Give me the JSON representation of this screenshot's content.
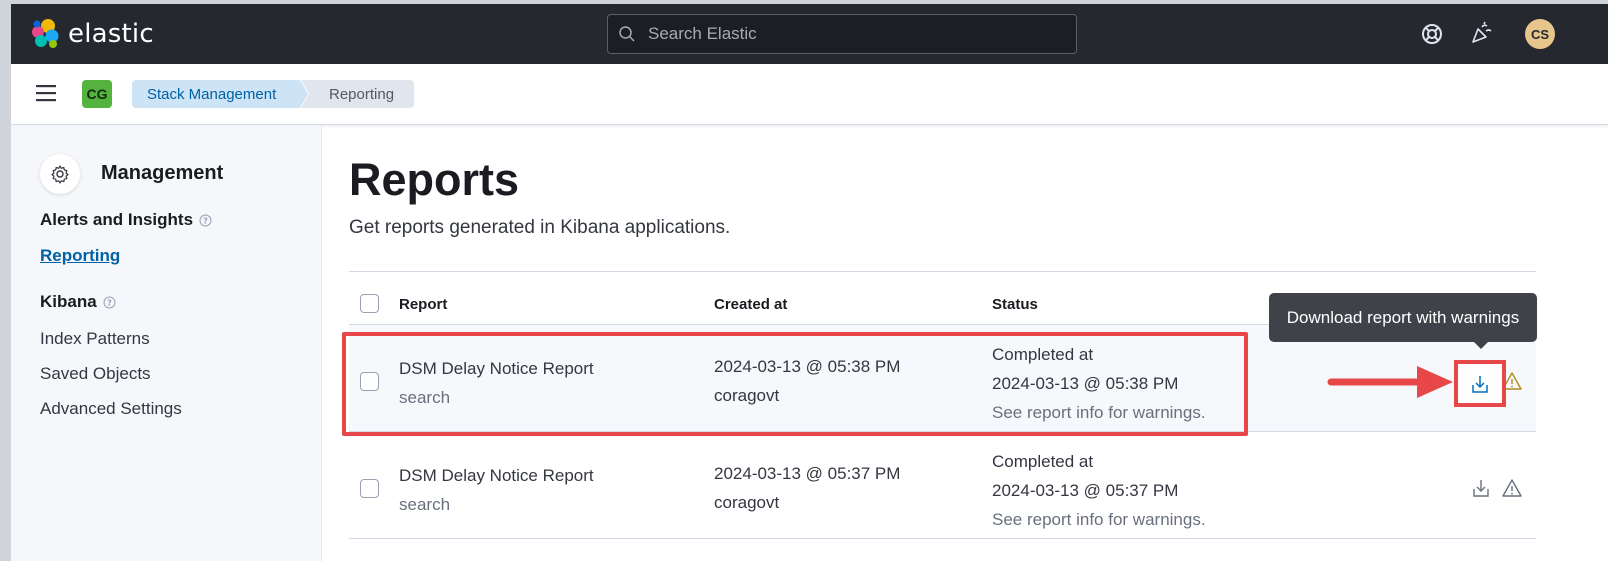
{
  "header": {
    "brand": "elastic",
    "search_placeholder": "Search Elastic",
    "help_icon": "help-lifebuoy-icon",
    "news_icon": "newsfeed-icon",
    "user_initials": "CS",
    "colors": {
      "bar": "#25282f",
      "avatar": "#e7c68b"
    }
  },
  "subheader": {
    "menu_icon": "hamburger-menu-icon",
    "space_initials": "CG",
    "breadcrumbs": [
      "Stack Management",
      "Reporting"
    ],
    "colors": {
      "space": "#54b33e",
      "crumb_active": "#cce4f5"
    }
  },
  "sidebar": {
    "title": "Management",
    "groups": [
      {
        "label": "Alerts and Insights",
        "items": [
          {
            "label": "Reporting",
            "active": true
          }
        ]
      },
      {
        "label": "Kibana",
        "items": [
          {
            "label": "Index Patterns"
          },
          {
            "label": "Saved Objects"
          },
          {
            "label": "Advanced Settings"
          }
        ]
      }
    ]
  },
  "main": {
    "title": "Reports",
    "description": "Get reports generated in Kibana applications.",
    "table": {
      "columns": [
        "Report",
        "Created at",
        "Status"
      ],
      "rows": [
        {
          "report": "DSM Delay Notice Report",
          "type": "search",
          "created": "2024-03-13 @ 05:38 PM",
          "user": "coragovt",
          "status_label": "Completed at",
          "status_time": "2024-03-13 @ 05:38 PM",
          "status_note": "See report info for warnings.",
          "highlighted": true
        },
        {
          "report": "DSM Delay Notice Report",
          "type": "search",
          "created": "2024-03-13 @ 05:37 PM",
          "user": "coragovt",
          "status_label": "Completed at",
          "status_time": "2024-03-13 @ 05:37 PM",
          "status_note": "See report info for warnings.",
          "highlighted": false
        }
      ]
    },
    "tooltip": "Download report with warnings",
    "annotation_color": "#e8474a"
  }
}
